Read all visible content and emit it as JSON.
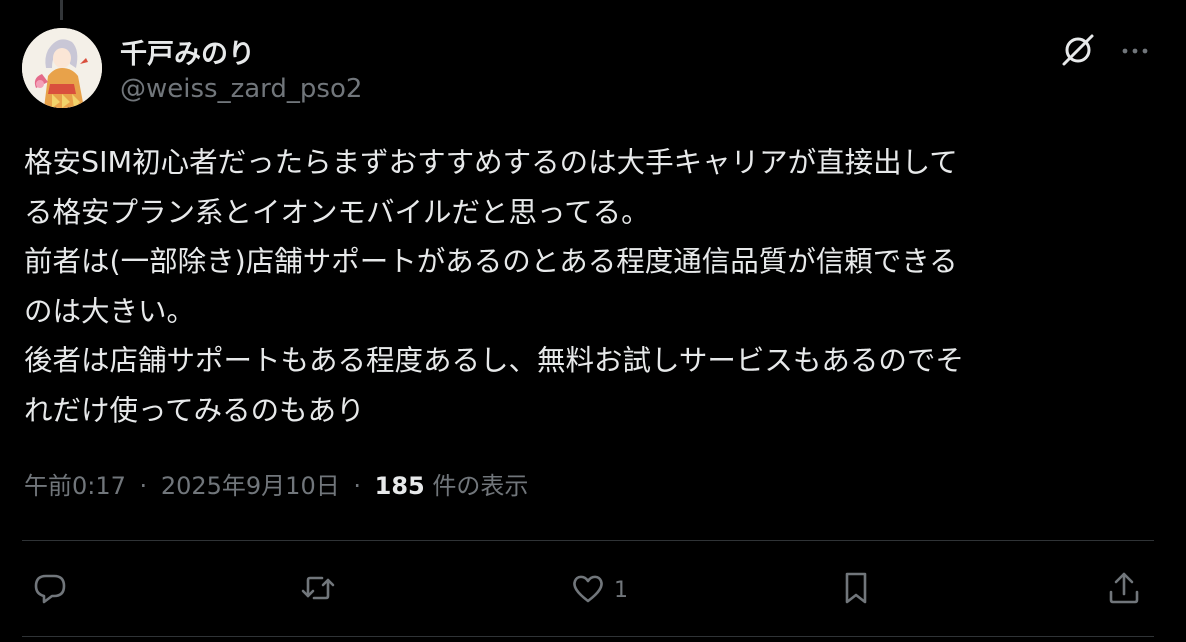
{
  "author": {
    "name": "千戸みのり",
    "handle": "@weiss_zard_pso2"
  },
  "post": {
    "lines": [
      "格安SIM初心者だったらまずおすすめするのは大手キャリアが直接出して",
      "る格安プラン系とイオンモバイルだと思ってる。",
      "前者は(一部除き)店舗サポートがあるのとある程度通信品質が信頼できる",
      "のは大きい。",
      "後者は店舗サポートもある程度あるし、無料お試しサービスもあるのでそ",
      "れだけ使ってみるのもあり"
    ]
  },
  "meta": {
    "time": "午前0:17",
    "date": "2025年9月10日",
    "separator": "·",
    "views_count": "185",
    "views_label": "件の表示"
  },
  "actions": {
    "reply_count": "",
    "repost_count": "",
    "like_count": "1",
    "bookmark_count": ""
  },
  "icons": {
    "header": [
      "grok-icon",
      "more-icon"
    ],
    "actions": [
      "reply-icon",
      "repost-icon",
      "like-icon",
      "bookmark-icon",
      "share-icon"
    ]
  },
  "colors": {
    "background": "#000000",
    "text_primary": "#e7e9ea",
    "text_secondary": "#71767b",
    "divider": "#2f3336"
  }
}
